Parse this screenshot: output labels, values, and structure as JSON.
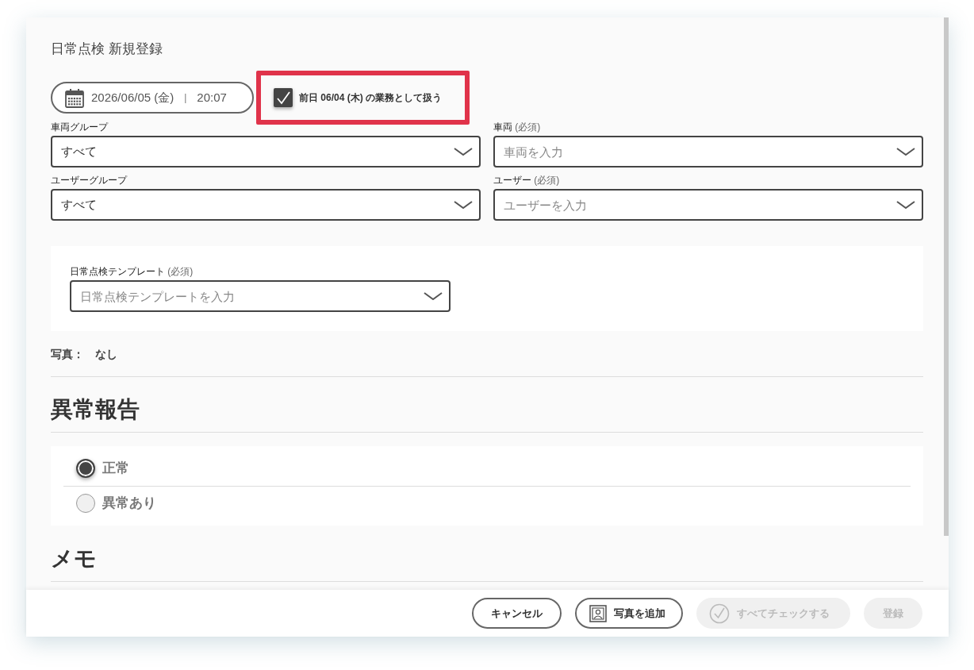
{
  "dialog": {
    "title": "日常点検 新規登録"
  },
  "date_time": {
    "date": "2026/06/05 (金)",
    "separator": "|",
    "time": "20:07"
  },
  "previous_day_option": {
    "label": "前日 06/04 (木) の業務として扱う",
    "checked": true,
    "highlighted": true
  },
  "fields": [
    {
      "label": "車両グループ",
      "value": "すべて"
    },
    {
      "label": "車両",
      "note": "(必須)",
      "placeholder": "車両を入力"
    },
    {
      "label": "ユーザーグループ",
      "value": "すべて"
    },
    {
      "label": "ユーザー",
      "note": "(必須)",
      "placeholder": "ユーザーを入力"
    }
  ],
  "template_field": {
    "label": "日常点検テンプレート",
    "note": "(必須)",
    "placeholder": "日常点検テンプレートを入力"
  },
  "photos": {
    "label": "写真：",
    "value": "なし"
  },
  "anomaly_report": {
    "heading": "異常報告",
    "options": [
      {
        "label": "正常",
        "selected": true
      },
      {
        "label": "異常あり",
        "selected": false
      }
    ]
  },
  "memo": {
    "heading": "メモ"
  },
  "footer_buttons": [
    {
      "label": "キャンセル",
      "kind": "plain",
      "disabled": false
    },
    {
      "label": "写真を追加",
      "kind": "photo",
      "disabled": false
    },
    {
      "label": "すべてチェックする",
      "kind": "check",
      "disabled": true
    },
    {
      "label": "登録",
      "kind": "plain",
      "disabled": true
    }
  ]
}
